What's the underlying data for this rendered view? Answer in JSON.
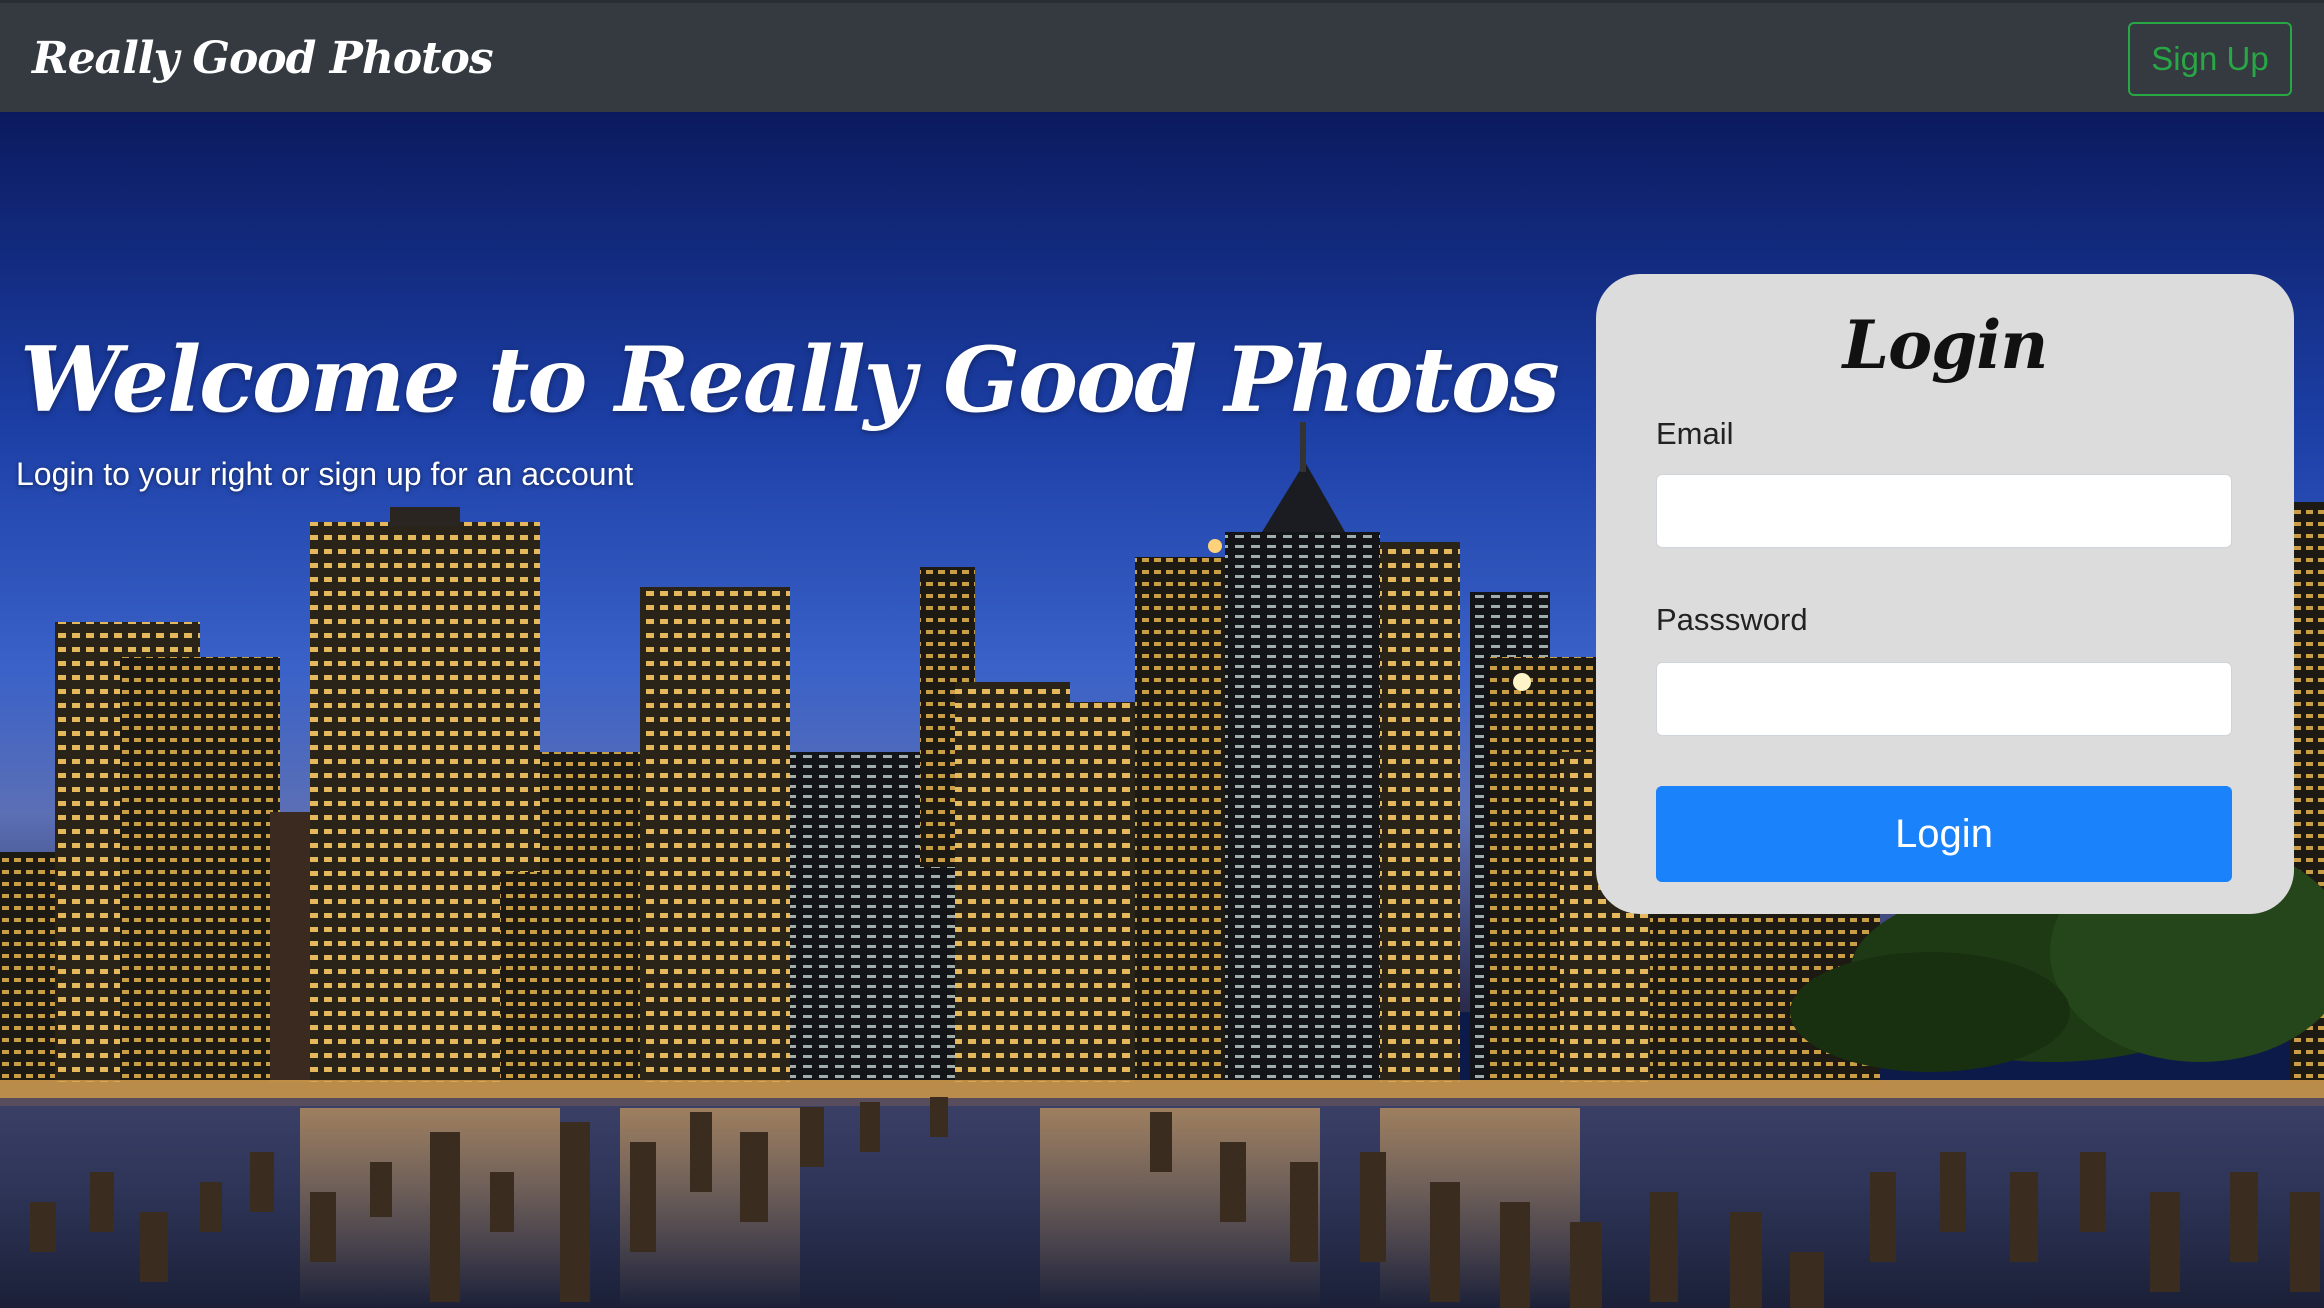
{
  "navbar": {
    "brand": "Really Good Photos",
    "signup_label": "Sign Up"
  },
  "hero": {
    "title": "Welcome to Really Good Photos",
    "subtitle": "Login to your right or sign up for an account",
    "background_image": "city-skyline-night-photo"
  },
  "login": {
    "title": "Login",
    "email_label": "Email",
    "email_value": "",
    "password_label": "Passsword",
    "password_value": "",
    "submit_label": "Login"
  },
  "colors": {
    "navbar_bg": "#343a40",
    "signup_accent": "#28a745",
    "login_card_bg": "#dcdcdc",
    "primary_button": "#1a82fb"
  }
}
